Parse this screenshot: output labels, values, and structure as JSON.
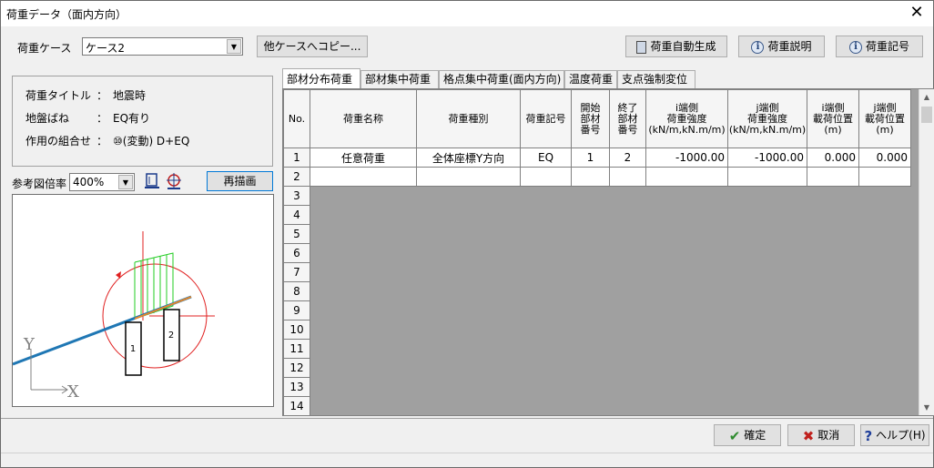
{
  "window": {
    "title": "荷重データ（面内方向）",
    "close": "✕"
  },
  "case": {
    "label": "荷重ケース",
    "value": "ケース2",
    "copy_button": "他ケースへコピー..."
  },
  "toolbar": {
    "auto_generate": "荷重自動生成",
    "description": "荷重説明",
    "symbol": "荷重記号"
  },
  "info": {
    "title_label": "荷重タイトル",
    "title_value": "地震時",
    "spring_label": "地盤ばね",
    "spring_value": "EQ有り",
    "combo_label": "作用の組合せ",
    "combo_value": "⑩(変動) D+EQ",
    "colon": "："
  },
  "preview": {
    "scale_label": "参考図倍率",
    "scale_value": "400%",
    "redraw_button": "再描画",
    "axis_y": "Y",
    "axis_x": "X",
    "member_1": "1",
    "member_2": "2"
  },
  "tabs": [
    {
      "label": "部材分布荷重",
      "active": true
    },
    {
      "label": "部材集中荷重",
      "active": false
    },
    {
      "label": "格点集中荷重(面内方向)",
      "active": false
    },
    {
      "label": "温度荷重",
      "active": false
    },
    {
      "label": "支点強制変位",
      "active": false
    }
  ],
  "grid": {
    "headers": {
      "no": "No.",
      "name": "荷重名称",
      "type": "荷重種別",
      "symbol": "荷重記号",
      "start_a": "開始",
      "start_b": "部材",
      "start_c": "番号",
      "end_a": "終了",
      "end_b": "部材",
      "end_c": "番号",
      "i_int_a": "i端側",
      "i_int_b": "荷重強度",
      "i_int_c": "(kN/m,kN.m/m)",
      "j_int_a": "j端側",
      "j_int_b": "荷重強度",
      "j_int_c": "(kN/m,kN.m/m)",
      "i_pos_a": "i端側",
      "i_pos_b": "載荷位置",
      "i_pos_c": "(m)",
      "j_pos_a": "j端側",
      "j_pos_b": "載荷位置",
      "j_pos_c": "(m)"
    },
    "row1": {
      "no": "1",
      "name": "任意荷重",
      "type": "全体座標Y方向",
      "symbol": "EQ",
      "start": "1",
      "end": "2",
      "i_int": "-1000.00",
      "j_int": "-1000.00",
      "i_pos": "0.000",
      "j_pos": "0.000"
    },
    "row_numbers": [
      "2",
      "3",
      "4",
      "5",
      "6",
      "7",
      "8",
      "9",
      "10",
      "11",
      "12",
      "13",
      "14"
    ]
  },
  "footer": {
    "ok": "確定",
    "cancel": "取消",
    "help": "ヘルプ(H)"
  },
  "colors": {
    "load_arrows": "#22cc22",
    "moment_circle": "#e02020",
    "frame_line": "#1f77b4",
    "frame_line2": "#e8882a",
    "members": "#000000"
  }
}
